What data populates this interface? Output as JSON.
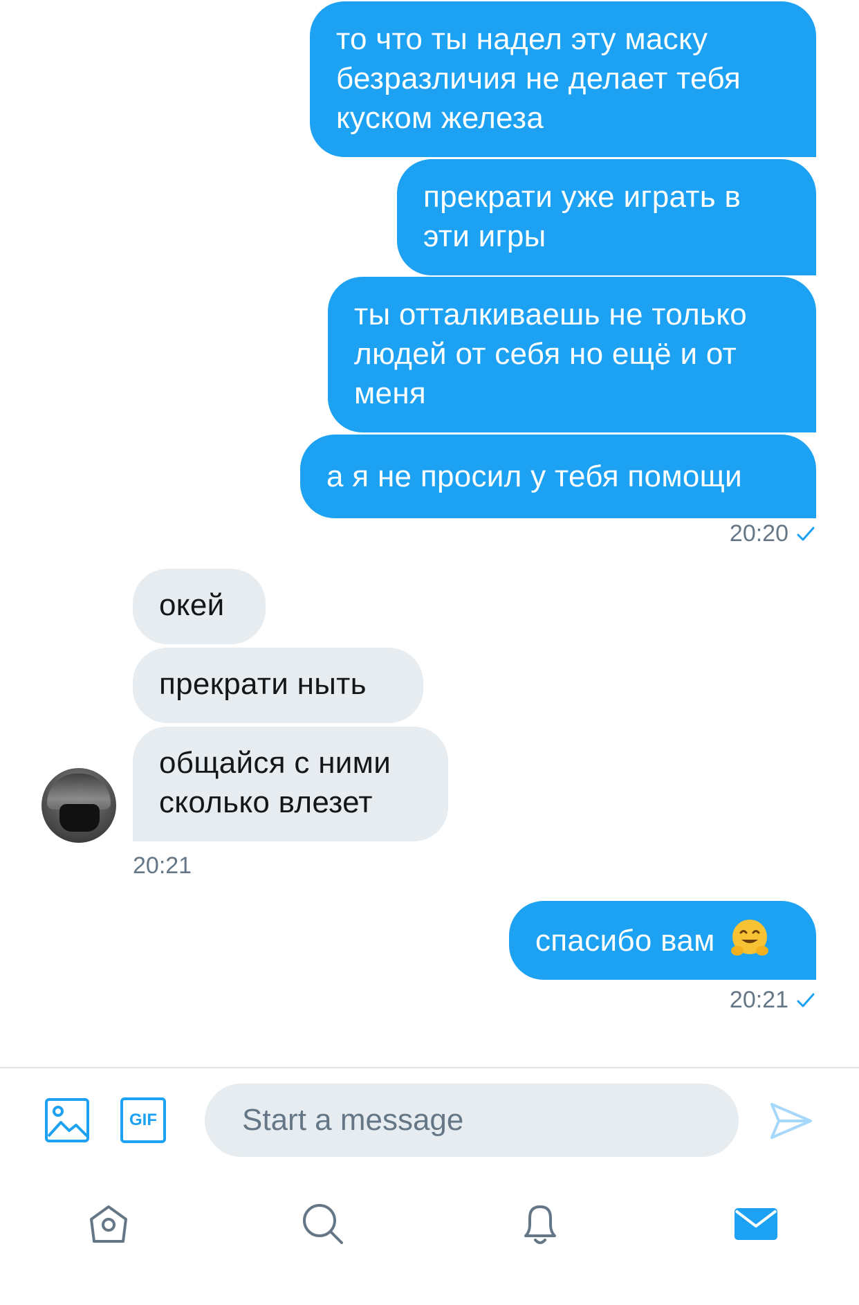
{
  "messages_out_1": [
    "то что ты надел эту маску безразличия не делает тебя куском железа",
    "прекрати уже играть в эти игры",
    "ты отталкиваешь не только людей от себя но ещё и от меня",
    "а я не просил у тебя помощи"
  ],
  "time_out_1": "20:20",
  "messages_in": [
    "окей",
    "прекрати ныть",
    "общайся с ними сколько влезет"
  ],
  "time_in": "20:21",
  "message_out_2": "спасибо вам",
  "message_out_2_emoji": "smiling-face-with-open-hands",
  "time_out_2": "20:21",
  "composer": {
    "placeholder": "Start a message",
    "gif_label": "GIF"
  },
  "colors": {
    "accent": "#1da1f2",
    "incoming_bubble": "#e6ecf0",
    "muted_text": "#657786"
  }
}
